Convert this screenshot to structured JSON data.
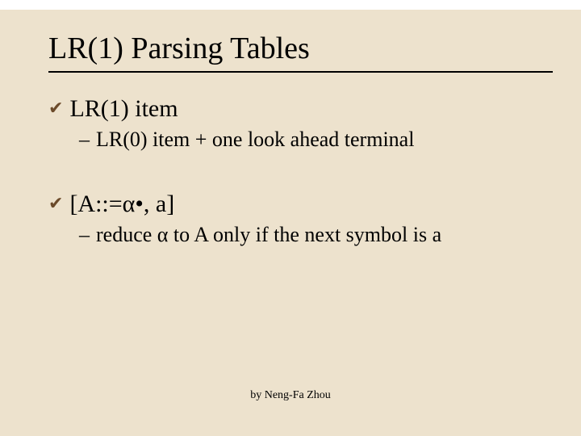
{
  "title": "LR(1) Parsing Tables",
  "items": [
    {
      "bullet": "LR(1) item",
      "sub": "LR(0) item + one look ahead terminal"
    },
    {
      "bullet": "[A::=α•, a]",
      "sub": "reduce α to A only if the next symbol is a"
    }
  ],
  "footer": "by Neng-Fa Zhou"
}
